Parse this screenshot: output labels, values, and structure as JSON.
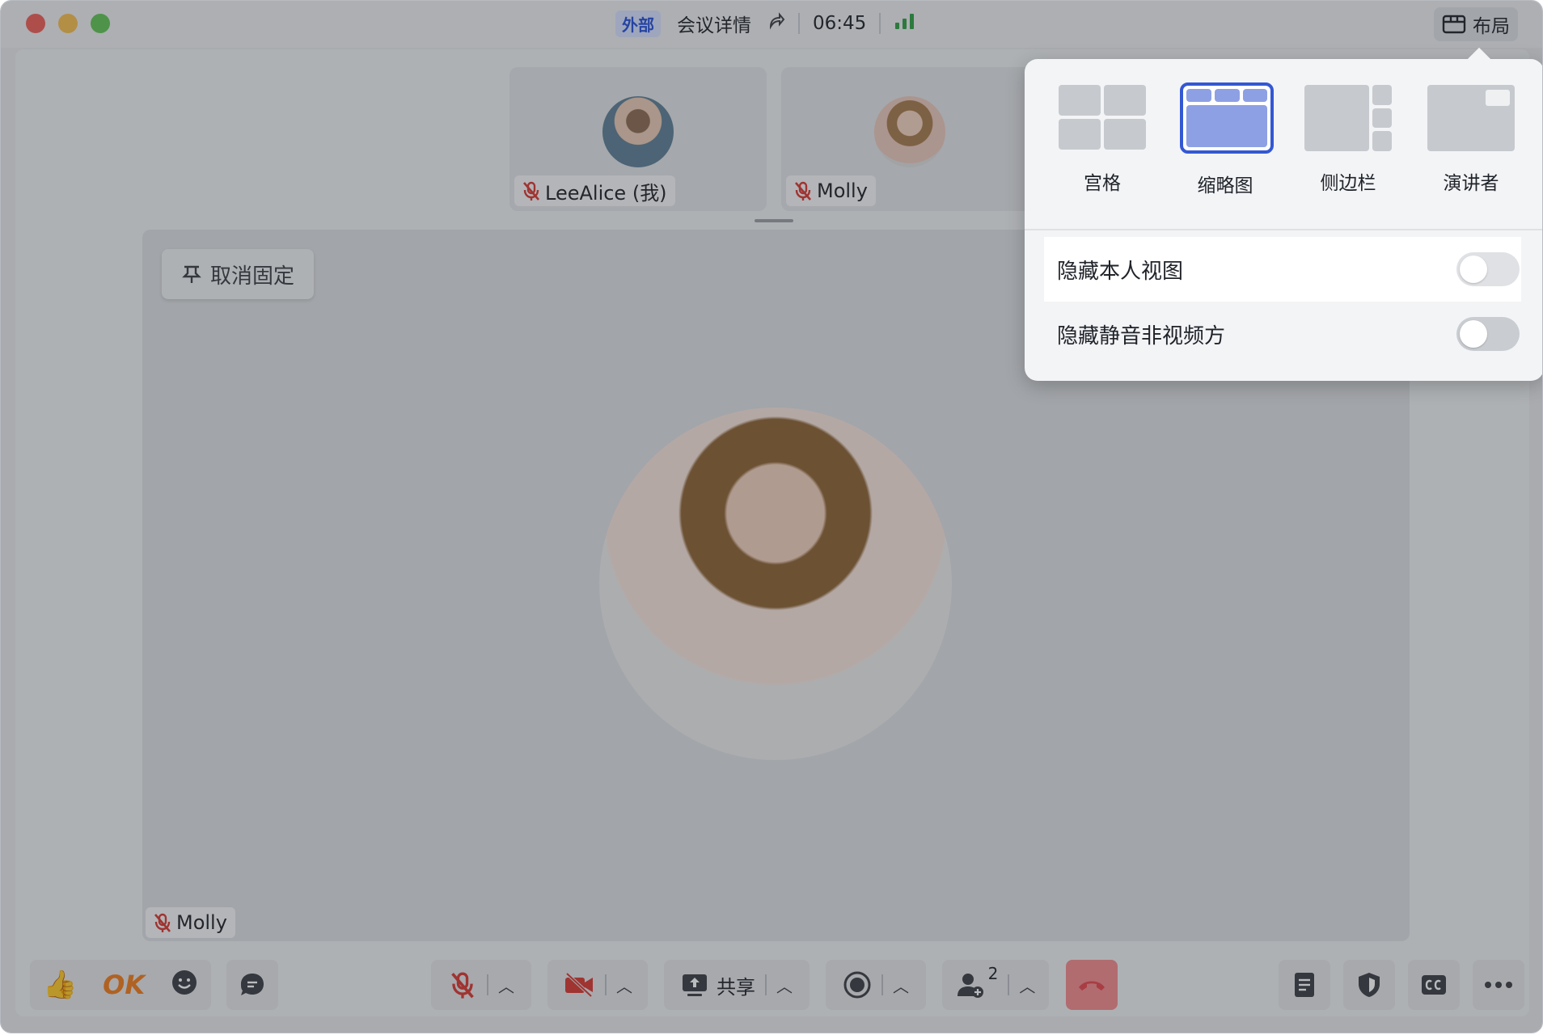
{
  "titlebar": {
    "tag": "外部",
    "meeting_details": "会议详情",
    "timer": "06:45",
    "layout_button": "布局"
  },
  "participants": [
    {
      "name": "LeeAlice (我)",
      "muted": true
    },
    {
      "name": "Molly",
      "muted": true
    }
  ],
  "main_view": {
    "unpin_label": "取消固定",
    "speaker_name": "Molly"
  },
  "layout_menu": {
    "options": [
      {
        "label": "宫格",
        "selected": false
      },
      {
        "label": "缩略图",
        "selected": true
      },
      {
        "label": "侧边栏",
        "selected": false
      },
      {
        "label": "演讲者",
        "selected": false
      }
    ],
    "toggles": [
      {
        "label": "隐藏本人视图",
        "on": false
      },
      {
        "label": "隐藏静音非视频方",
        "on": false
      }
    ],
    "accent": "#3358d4"
  },
  "toolbar": {
    "reaction_ok": "OK",
    "share_label": "共享",
    "participants_count": "2",
    "end_color": "#e5484d"
  }
}
